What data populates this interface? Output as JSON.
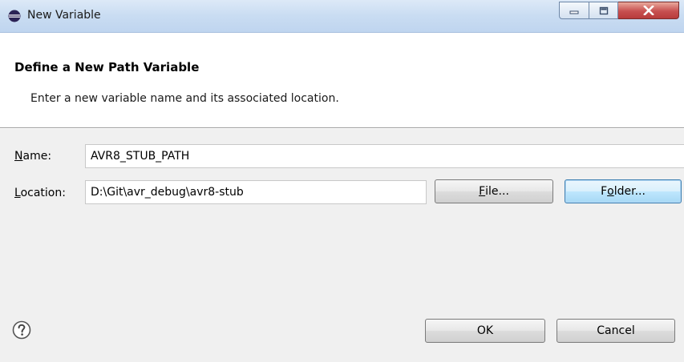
{
  "window": {
    "title": "New Variable",
    "icon": "eclipse-icon"
  },
  "header": {
    "title": "Define a New Path Variable",
    "description": "Enter a new variable name and its associated location."
  },
  "form": {
    "name_label_mnemonic": "N",
    "name_label_rest": "ame:",
    "name_value": "AVR8_STUB_PATH",
    "location_label_mnemonic": "L",
    "location_label_rest": "ocation:",
    "location_value": "D:\\Git\\avr_debug\\avr8-stub"
  },
  "buttons": {
    "file_mnemonic": "F",
    "file_rest": "ile...",
    "folder_pre": "F",
    "folder_mnemonic": "o",
    "folder_rest": "lder...",
    "ok": "OK",
    "cancel": "Cancel"
  },
  "icons": {
    "help": "help-icon",
    "minimize": "minimize-icon",
    "maximize": "maximize-icon",
    "close": "close-icon"
  }
}
